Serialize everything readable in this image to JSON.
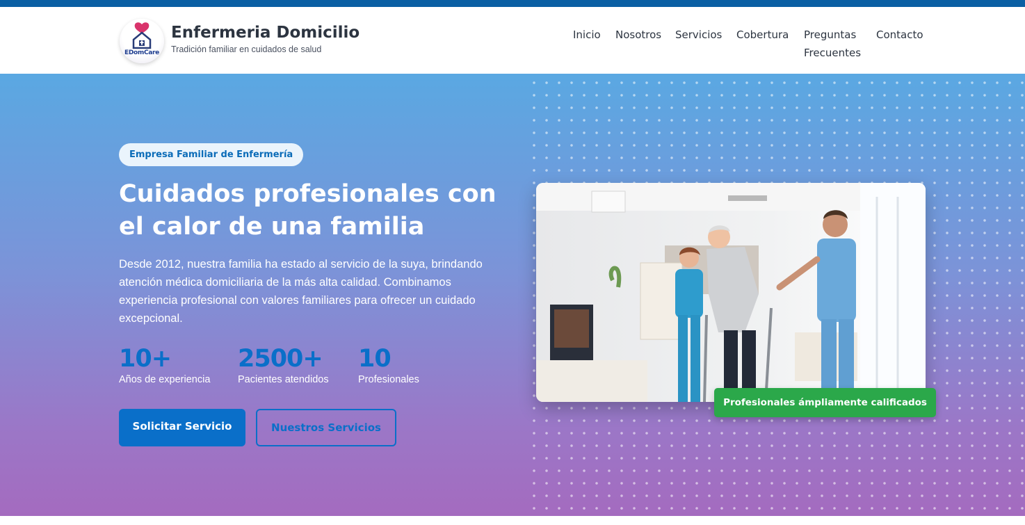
{
  "brand": {
    "logo_text": "EDomCare",
    "title": "Enfermeria Domicilio",
    "tagline": "Tradición familiar en cuidados de salud"
  },
  "nav": {
    "items": [
      "Inicio",
      "Nosotros",
      "Servicios",
      "Cobertura",
      "Preguntas Frecuentes",
      "Contacto"
    ]
  },
  "hero": {
    "badge": "Empresa Familiar de Enfermería",
    "headline": "Cuidados profesionales con el calor de una familia",
    "lead": "Desde 2012, nuestra familia ha estado al servicio de la suya, brindando atención médica domiciliaria de la más alta calidad. Combinamos experiencia profesional con valores familiares para ofrecer un cuidado excepcional.",
    "stats": [
      {
        "value": "10+",
        "label": "Años de experiencia"
      },
      {
        "value": "2500+",
        "label": "Pacientes atendidos"
      },
      {
        "value": "10",
        "label": "Profesionales"
      }
    ],
    "primary_button": "Solicitar Servicio",
    "secondary_button": "Nuestros Servicios",
    "photo_badge": "Profesionales ámpliamente calificados"
  },
  "colors": {
    "accent": "#0a6fc9",
    "top_strip": "#0a5fa3",
    "success": "#2ba84a",
    "gradient_top": "#5aa8e2",
    "gradient_bottom": "#a46bbf"
  }
}
